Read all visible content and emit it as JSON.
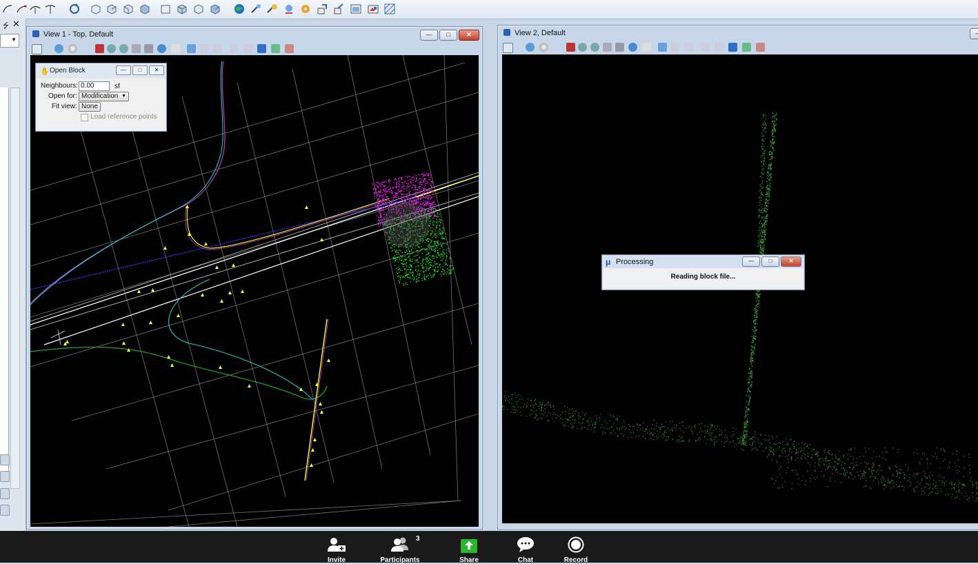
{
  "colors": {
    "canvas": "#000000",
    "magenta_points": "#e020e0",
    "green_points": "#22d022",
    "cyan_line": "#20c8c8",
    "green_line": "#20a830",
    "yellow_marker": "#ffff30",
    "share_green": "#2db42d"
  },
  "top_toolbar": {
    "icons": [
      "curve-tool-icon",
      "curve-tool-icon",
      "curve-tool-icon",
      "curve-tool-icon",
      "rotate-view-icon",
      "box-icon",
      "box-icon",
      "box-icon",
      "box-icon",
      "cube-icon",
      "cube-icon",
      "cube-icon",
      "cube-icon",
      "globe-icon",
      "tool-icon",
      "tool-icon",
      "tool-icon",
      "tool-icon",
      "tool-icon",
      "tool-icon",
      "tool-icon",
      "tool-icon",
      "tool-icon"
    ]
  },
  "view1": {
    "title": "View 1 - Top, Default"
  },
  "view2": {
    "title": "View 2, Default"
  },
  "open_block": {
    "title": "Open Block",
    "neighbours_label": "Neighbours:",
    "neighbours_value": "0.00",
    "neighbours_unit": "sf",
    "open_for_label": "Open for:",
    "open_for_value": "Modification",
    "fit_view_label": "Fit view:",
    "fit_view_value": "None",
    "load_reference_label": "Load reference points"
  },
  "processing": {
    "title": "Processing",
    "message": "Reading block file..."
  },
  "meeting_bar": {
    "invite": "Invite",
    "participants": "Participants",
    "participants_count": "3",
    "share": "Share",
    "chat": "Chat",
    "record": "Record"
  }
}
